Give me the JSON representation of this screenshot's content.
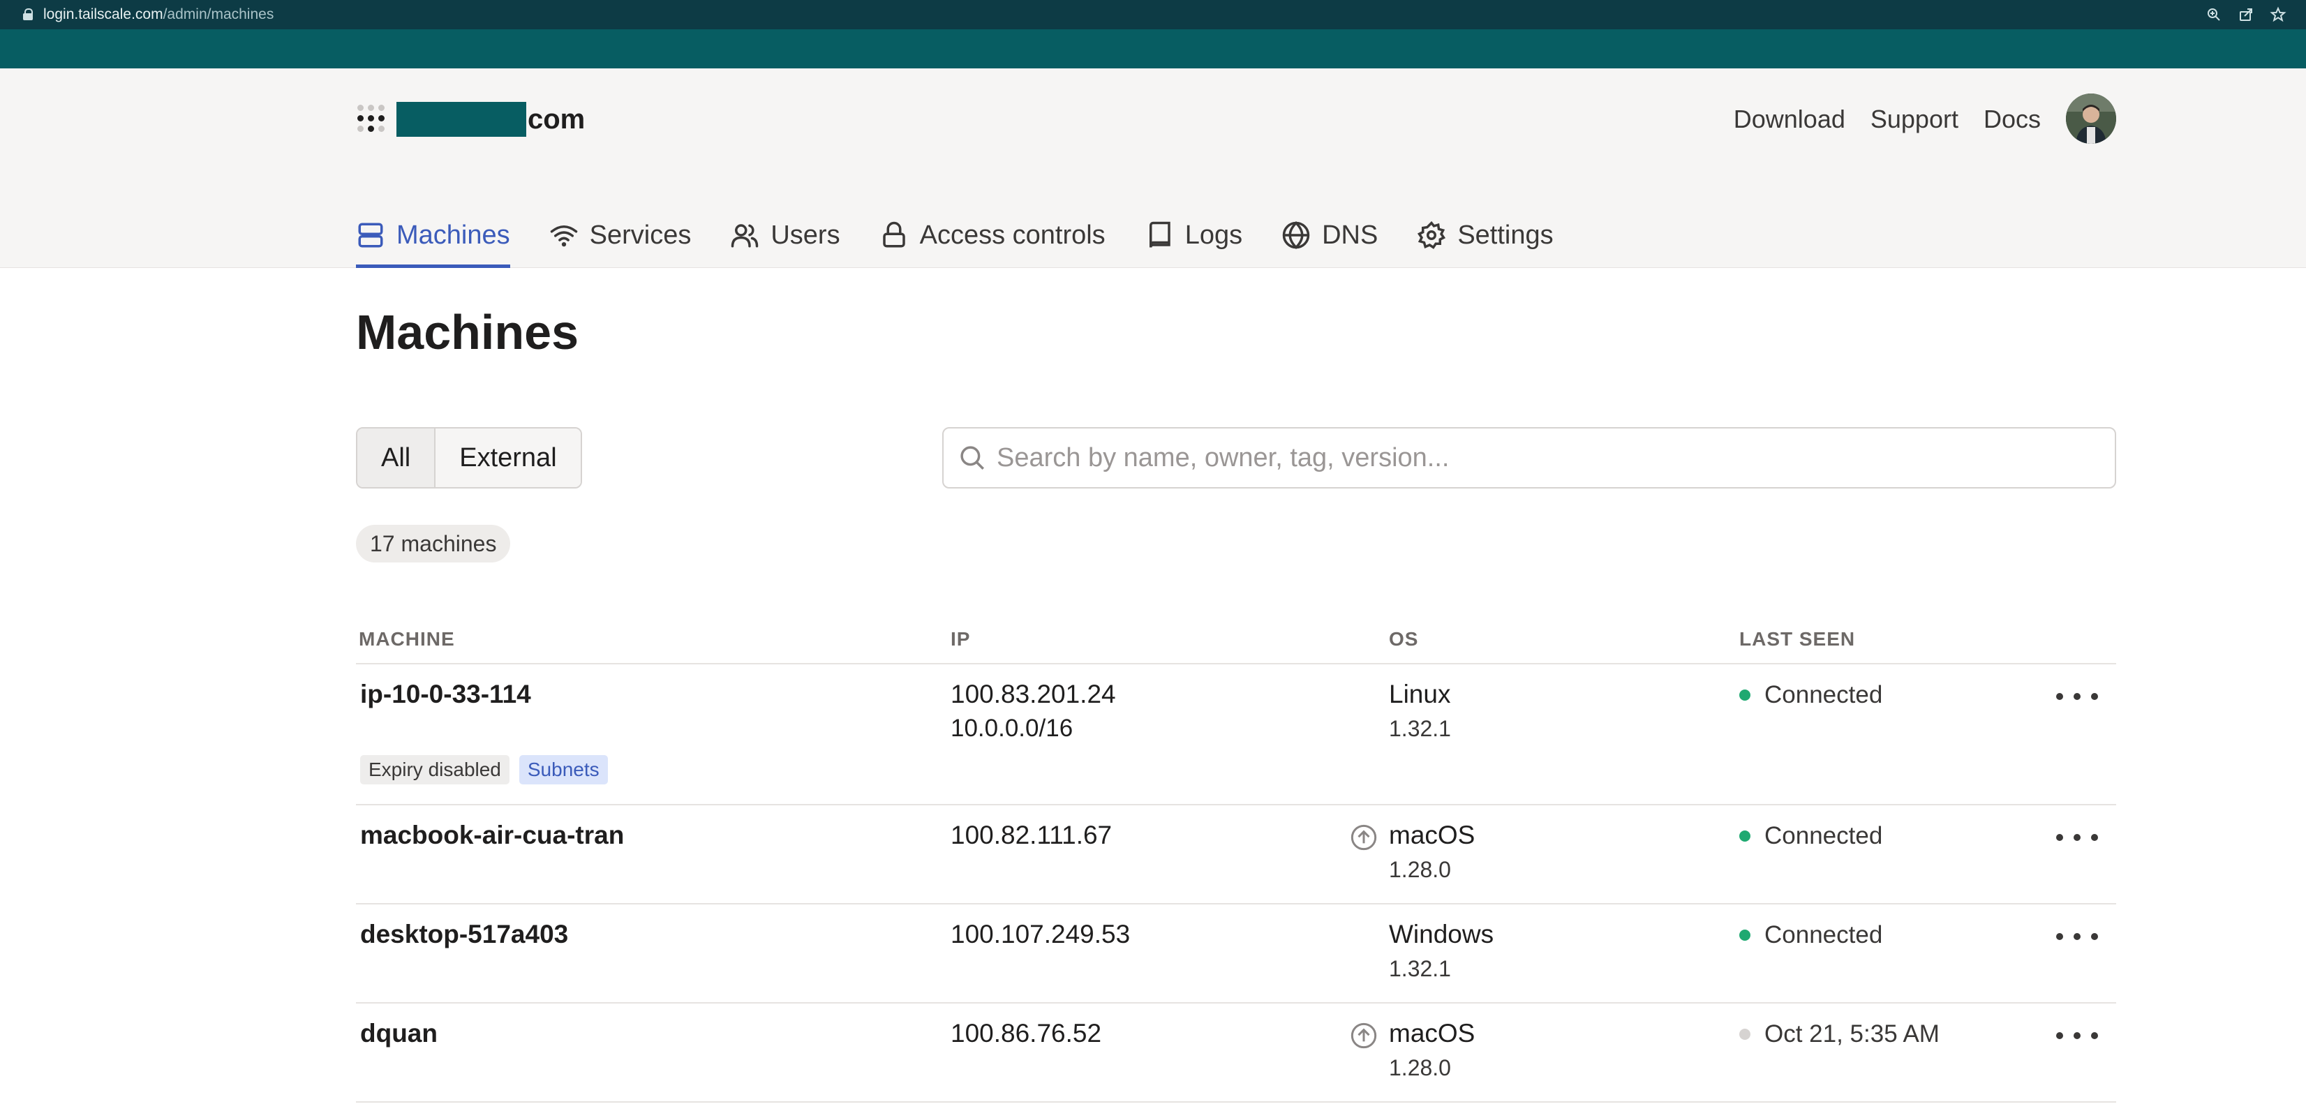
{
  "browser": {
    "url_host": "login.tailscale.com",
    "url_path": "/admin/machines"
  },
  "header": {
    "org_suffix": "com",
    "links": [
      "Download",
      "Support",
      "Docs"
    ]
  },
  "nav": {
    "tabs": [
      "Machines",
      "Services",
      "Users",
      "Access controls",
      "Logs",
      "DNS",
      "Settings"
    ]
  },
  "main": {
    "title": "Machines",
    "filter": {
      "all_label": "All",
      "external_label": "External"
    },
    "search": {
      "placeholder": "Search by name, owner, tag, version..."
    },
    "count": "17 machines",
    "columns": [
      "MACHINE",
      "IP",
      "OS",
      "LAST SEEN"
    ],
    "rows": [
      {
        "name": "ip-10-0-33-114",
        "ip": "100.83.201.24",
        "ip2": "10.0.0.0/16",
        "os": "Linux",
        "os_version": "1.32.1",
        "last_seen": "Connected",
        "tags": [
          "Expiry disabled",
          "Subnets"
        ]
      },
      {
        "name": "macbook-air-cua-tran",
        "ip": "100.82.111.67",
        "os": "macOS",
        "os_version": "1.28.0",
        "last_seen": "Connected",
        "update_available": true
      },
      {
        "name": "desktop-517a403",
        "ip": "100.107.249.53",
        "os": "Windows",
        "os_version": "1.32.1",
        "last_seen": "Connected"
      },
      {
        "name": "dquan",
        "ip": "100.86.76.52",
        "os": "macOS",
        "os_version": "1.28.0",
        "last_seen": "Oct 21, 5:35 AM",
        "update_available": true
      }
    ]
  },
  "colors": {
    "accent": "#3b5bba",
    "brand_teal": "#075d62",
    "connected": "#1fa971",
    "offline": "#d6d3d1"
  },
  "icons": [
    "lock-icon",
    "zoom-icon",
    "share-icon",
    "star-icon",
    "server-icon",
    "wifi-icon",
    "users-icon",
    "lock-icon",
    "book-icon",
    "globe-icon",
    "gear-icon",
    "search-icon",
    "arrow-up-circle-icon",
    "more-icon"
  ]
}
